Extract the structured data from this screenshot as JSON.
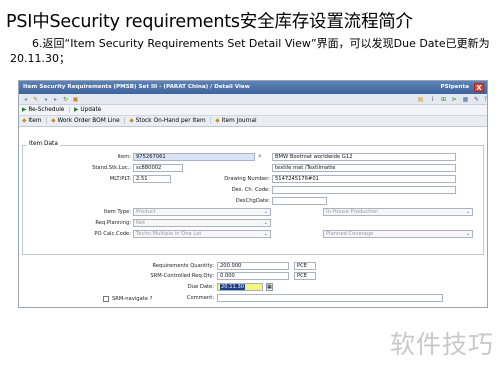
{
  "slide": {
    "title": "PSI中Security requirements安全库存设置流程简介",
    "body": "6.返回“Item Security Requirements Set Detail View”界面，可以发现Due Date已更新为20.11.30；"
  },
  "window": {
    "title": "Item Security Requirements (PMSB) Set III - (PARAT China) / Detail View",
    "brand": "PSIpenta",
    "close_label": "X"
  },
  "toolbar": {
    "reschedule_label": "Re-Schedule",
    "update_label": "Update"
  },
  "tabs": [
    {
      "label": "Item"
    },
    {
      "label": "Work Order BOM Line"
    },
    {
      "label": "Stock On-Hand per Item"
    },
    {
      "label": "Item Journal"
    }
  ],
  "item_data": {
    "section_label": "Item Data",
    "item_label": "Item:",
    "item_value": "975267061",
    "item_desc": "BMW Bootmat worldwide G12",
    "stock_loc_label": "Stand.Stk.Loc.:",
    "stock_loc_value": "sc880002",
    "stock_loc_desc": "textile mat /Textilmatte",
    "mlt_label": "MLT/PLT:",
    "mlt_value": "2.51",
    "drawing_label": "Drawing Number:",
    "drawing_value": "5147245176#01",
    "des_code_label": "Des. Ch. Code:",
    "des_date_label": "DesChgDate:",
    "item_type_label": "Item Type:",
    "item_type_value": "Product",
    "production_value": "In-House Production",
    "req_planning_label": "Req.Planning:",
    "req_planning_value": "Net",
    "po_calc_label": "PO Calc.Code:",
    "po_calc_value": "Techn.Multiple in One Lot",
    "coverage_value": "Planned Coverage"
  },
  "requirements": {
    "qty_label": "Requirements Quantity:",
    "qty_value": "200.000",
    "qty_unit": "PCE",
    "srm_qty_label": "SRM-Controlled Req.Qty:",
    "srm_qty_value": "0.000",
    "srm_qty_unit": "PCE",
    "due_label": "Due Date:",
    "due_value": "20.11.30",
    "comment_label": "Comment:",
    "comment_value": "",
    "srm_navigate_label": "SRM-navigate ?"
  },
  "watermark": "软件技巧",
  "icons": [
    "back-icon",
    "forward-icon",
    "refresh-icon",
    "save-icon",
    "help-icon",
    "print-icon",
    "calendar-icon",
    "search-icon",
    "close-icon"
  ]
}
